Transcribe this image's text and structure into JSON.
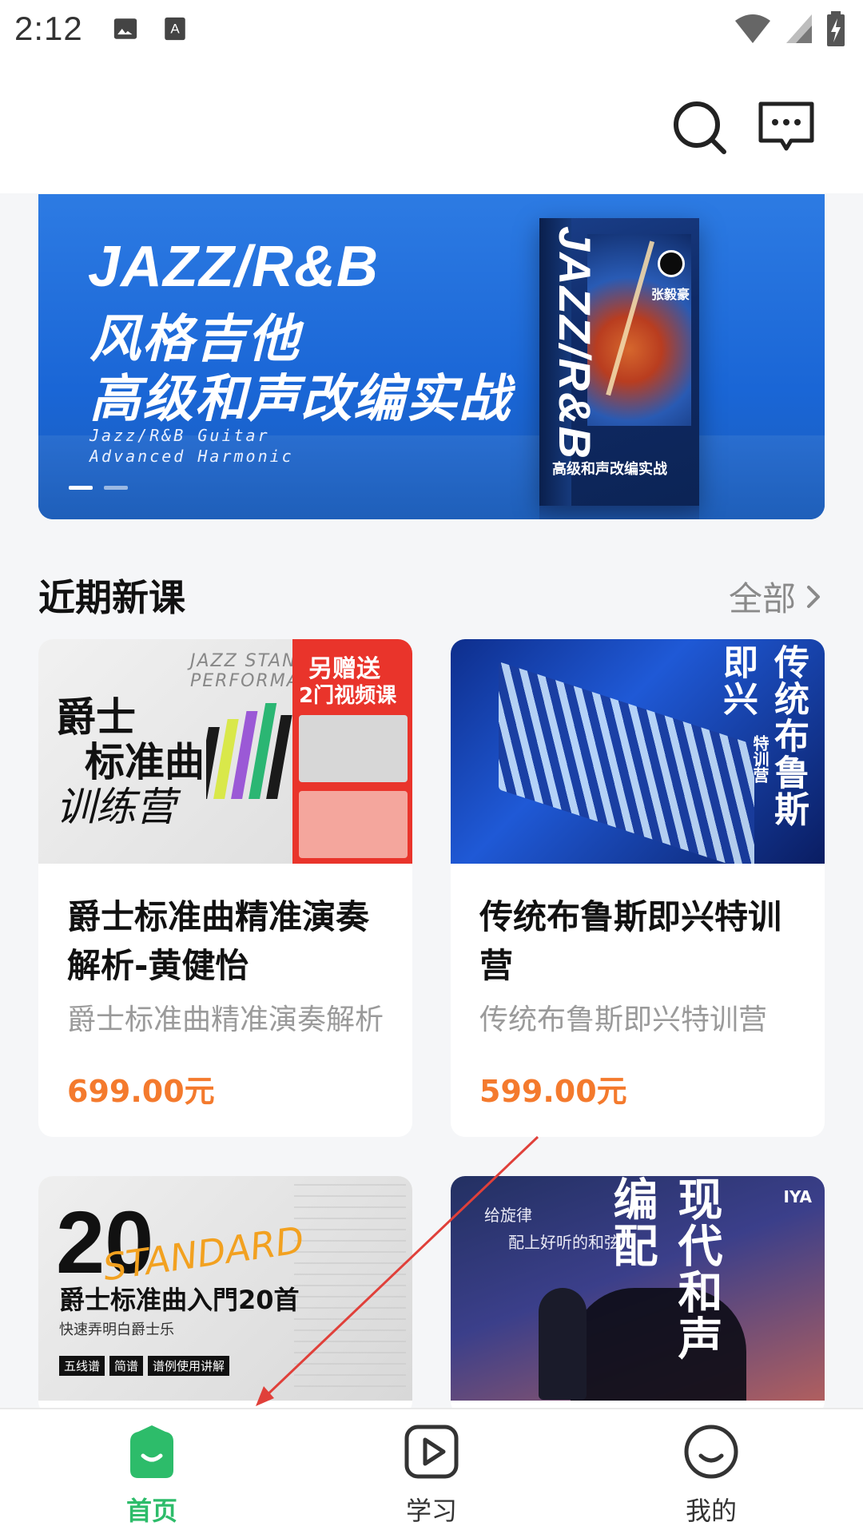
{
  "status_bar": {
    "time": "2:12"
  },
  "banner": {
    "title_line1": "JAZZ/R&B",
    "title_line2": "风格吉他",
    "title_line3": "高级和声改编实战",
    "subtitle_line1": "Jazz/R&B Guitar",
    "subtitle_line2": "Advanced Harmonic",
    "book_vertical": "JAZZ/R&B",
    "book_author": "张毅豪",
    "book_bottom": "高级和声改编实战",
    "dots": 2,
    "active_dot": 0
  },
  "section": {
    "title": "近期新课",
    "more": "全部"
  },
  "courses": [
    {
      "title": "爵士标准曲精准演奏解析-黄健怡",
      "subtitle": "爵士标准曲精准演奏解析",
      "price": "699.00元",
      "image": {
        "std_text": "JAZZ STANDARDS PERFORMANCE",
        "main_text_line1": "爵士",
        "main_text_line2": "标准曲",
        "main_text_line3": "训练营",
        "promo_line1": "另赠送",
        "promo_line2": "2门视频课"
      }
    },
    {
      "title": "传统布鲁斯即兴特训营",
      "subtitle": "传统布鲁斯即兴特训营",
      "price": "599.00元",
      "image": {
        "vertical_text": "传统布鲁斯即兴",
        "vertical_small": "特训营"
      }
    },
    {
      "image": {
        "number": "20",
        "std_text": "STANDARD",
        "title": "爵士标准曲入門20首",
        "sub": "快速弄明白爵士乐",
        "tags": [
          "五线谱",
          "简谱",
          "谱例使用讲解"
        ]
      }
    },
    {
      "image": {
        "text_line1": "给旋律",
        "text_line2": "配上好听的和弦",
        "vertical_text": "现代和声编配",
        "brand": "IYA"
      }
    }
  ],
  "bottom_nav": [
    {
      "label": "首页",
      "active": true
    },
    {
      "label": "学习",
      "active": false
    },
    {
      "label": "我的",
      "active": false
    }
  ],
  "colors": {
    "accent": "#2dbc6a",
    "price": "#f47a2d",
    "annotation_arrow": "#e0403a"
  }
}
